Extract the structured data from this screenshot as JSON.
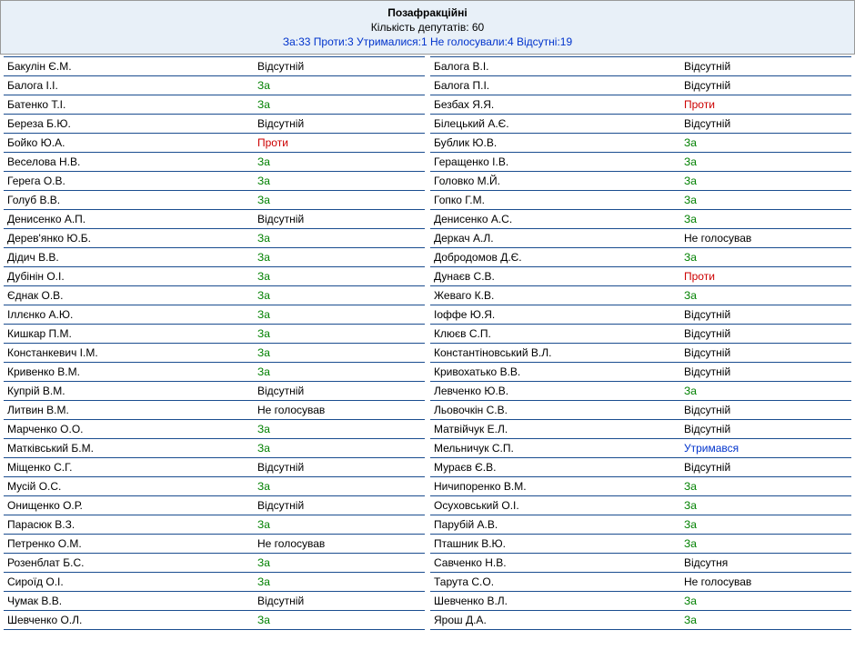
{
  "header": {
    "title": "Позафракційні",
    "count": "Кількість депутатів: 60",
    "summary": "За:33 Проти:3 Утрималися:1 Не голосували:4 Відсутні:19"
  },
  "leftRows": [
    {
      "name": "Бакулін Є.М.",
      "vote": "Відсутній",
      "cls": "vote-absent"
    },
    {
      "name": "Балога І.І.",
      "vote": "За",
      "cls": "vote-za"
    },
    {
      "name": "Батенко Т.І.",
      "vote": "За",
      "cls": "vote-za"
    },
    {
      "name": "Береза Б.Ю.",
      "vote": "Відсутній",
      "cls": "vote-absent"
    },
    {
      "name": "Бойко Ю.А.",
      "vote": "Проти",
      "cls": "vote-proty"
    },
    {
      "name": "Веселова Н.В.",
      "vote": "За",
      "cls": "vote-za"
    },
    {
      "name": "Герега О.В.",
      "vote": "За",
      "cls": "vote-za"
    },
    {
      "name": "Голуб В.В.",
      "vote": "За",
      "cls": "vote-za"
    },
    {
      "name": "Денисенко А.П.",
      "vote": "Відсутній",
      "cls": "vote-absent"
    },
    {
      "name": "Дерев'янко Ю.Б.",
      "vote": "За",
      "cls": "vote-za"
    },
    {
      "name": "Дідич В.В.",
      "vote": "За",
      "cls": "vote-za"
    },
    {
      "name": "Дубінін О.І.",
      "vote": "За",
      "cls": "vote-za"
    },
    {
      "name": "Єднак О.В.",
      "vote": "За",
      "cls": "vote-za"
    },
    {
      "name": "Іллєнко А.Ю.",
      "vote": "За",
      "cls": "vote-za"
    },
    {
      "name": "Кишкар П.М.",
      "vote": "За",
      "cls": "vote-za"
    },
    {
      "name": "Констанкевич І.М.",
      "vote": "За",
      "cls": "vote-za"
    },
    {
      "name": "Кривенко В.М.",
      "vote": "За",
      "cls": "vote-za"
    },
    {
      "name": "Купрій В.М.",
      "vote": "Відсутній",
      "cls": "vote-absent"
    },
    {
      "name": "Литвин В.М.",
      "vote": "Не голосував",
      "cls": "vote-novote"
    },
    {
      "name": "Марченко О.О.",
      "vote": "За",
      "cls": "vote-za"
    },
    {
      "name": "Матківський Б.М.",
      "vote": "За",
      "cls": "vote-za"
    },
    {
      "name": "Міщенко С.Г.",
      "vote": "Відсутній",
      "cls": "vote-absent"
    },
    {
      "name": "Мусій О.С.",
      "vote": "За",
      "cls": "vote-za"
    },
    {
      "name": "Онищенко О.Р.",
      "vote": "Відсутній",
      "cls": "vote-absent"
    },
    {
      "name": "Парасюк В.З.",
      "vote": "За",
      "cls": "vote-za"
    },
    {
      "name": "Петренко О.М.",
      "vote": "Не голосував",
      "cls": "vote-novote"
    },
    {
      "name": "Розенблат Б.С.",
      "vote": "За",
      "cls": "vote-za"
    },
    {
      "name": "Сироїд О.І.",
      "vote": "За",
      "cls": "vote-za"
    },
    {
      "name": "Чумак В.В.",
      "vote": "Відсутній",
      "cls": "vote-absent"
    },
    {
      "name": "Шевченко О.Л.",
      "vote": "За",
      "cls": "vote-za"
    }
  ],
  "rightRows": [
    {
      "name": "Балога В.І.",
      "vote": "Відсутній",
      "cls": "vote-absent"
    },
    {
      "name": "Балога П.І.",
      "vote": "Відсутній",
      "cls": "vote-absent"
    },
    {
      "name": "Безбах Я.Я.",
      "vote": "Проти",
      "cls": "vote-proty"
    },
    {
      "name": "Білецький А.Є.",
      "vote": "Відсутній",
      "cls": "vote-absent"
    },
    {
      "name": "Бублик Ю.В.",
      "vote": "За",
      "cls": "vote-za"
    },
    {
      "name": "Геращенко І.В.",
      "vote": "За",
      "cls": "vote-za"
    },
    {
      "name": "Головко М.Й.",
      "vote": "За",
      "cls": "vote-za"
    },
    {
      "name": "Гопко Г.М.",
      "vote": "За",
      "cls": "vote-za"
    },
    {
      "name": "Денисенко А.С.",
      "vote": "За",
      "cls": "vote-za"
    },
    {
      "name": "Деркач А.Л.",
      "vote": "Не голосував",
      "cls": "vote-novote"
    },
    {
      "name": "Добродомов Д.Є.",
      "vote": "За",
      "cls": "vote-za"
    },
    {
      "name": "Дунаєв С.В.",
      "vote": "Проти",
      "cls": "vote-proty"
    },
    {
      "name": "Жеваго К.В.",
      "vote": "За",
      "cls": "vote-za"
    },
    {
      "name": "Іоффе Ю.Я.",
      "vote": "Відсутній",
      "cls": "vote-absent"
    },
    {
      "name": "Клюєв С.П.",
      "vote": "Відсутній",
      "cls": "vote-absent"
    },
    {
      "name": "Константіновський В.Л.",
      "vote": "Відсутній",
      "cls": "vote-absent"
    },
    {
      "name": "Кривохатько В.В.",
      "vote": "Відсутній",
      "cls": "vote-absent"
    },
    {
      "name": "Левченко Ю.В.",
      "vote": "За",
      "cls": "vote-za"
    },
    {
      "name": "Льовочкін С.В.",
      "vote": "Відсутній",
      "cls": "vote-absent"
    },
    {
      "name": "Матвійчук Е.Л.",
      "vote": "Відсутній",
      "cls": "vote-absent"
    },
    {
      "name": "Мельничук С.П.",
      "vote": "Утримався",
      "cls": "vote-abstain"
    },
    {
      "name": "Мураєв Є.В.",
      "vote": "Відсутній",
      "cls": "vote-absent"
    },
    {
      "name": "Ничипоренко В.М.",
      "vote": "За",
      "cls": "vote-za"
    },
    {
      "name": "Осуховський О.І.",
      "vote": "За",
      "cls": "vote-za"
    },
    {
      "name": "Парубій А.В.",
      "vote": "За",
      "cls": "vote-za"
    },
    {
      "name": "Пташник В.Ю.",
      "vote": "За",
      "cls": "vote-za"
    },
    {
      "name": "Савченко Н.В.",
      "vote": "Відсутня",
      "cls": "vote-absent"
    },
    {
      "name": "Тарута С.О.",
      "vote": "Не голосував",
      "cls": "vote-novote"
    },
    {
      "name": "Шевченко В.Л.",
      "vote": "За",
      "cls": "vote-za"
    },
    {
      "name": "Ярош Д.А.",
      "vote": "За",
      "cls": "vote-za"
    }
  ]
}
